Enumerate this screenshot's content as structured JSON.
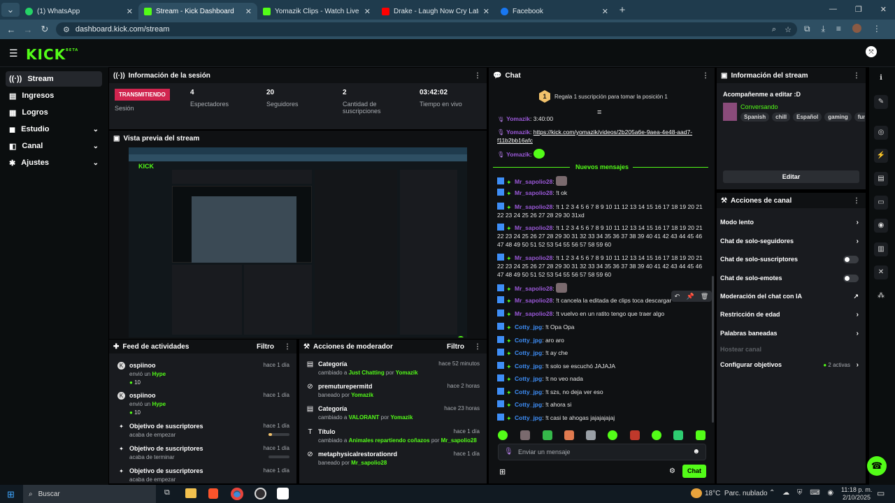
{
  "browser": {
    "tabs": [
      {
        "title": "(1) WhatsApp",
        "color": "#25d366"
      },
      {
        "title": "Stream - Kick Dashboard",
        "color": "#53fc18"
      },
      {
        "title": "Yomazik Clips - Watch Live on",
        "color": "#53fc18"
      },
      {
        "title": "Drake - Laugh Now Cry Later (C",
        "color": "#ff0000"
      },
      {
        "title": "Facebook",
        "color": "#1877f2"
      }
    ],
    "url": "dashboard.kick.com/stream"
  },
  "kick": {
    "logo": "KICK",
    "beta": "BETA",
    "sidebar": [
      {
        "label": "Stream",
        "icon": "broadcast-icon",
        "active": true
      },
      {
        "label": "Ingresos",
        "icon": "money-icon"
      },
      {
        "label": "Logros",
        "icon": "trophy-icon"
      },
      {
        "label": "Estudio",
        "icon": "studio-icon",
        "expand": true
      },
      {
        "label": "Canal",
        "icon": "channel-icon",
        "expand": true
      },
      {
        "label": "Ajustes",
        "icon": "gear-icon",
        "expand": true
      }
    ]
  },
  "session": {
    "title": "Información de la sesión",
    "badge": "TRANSMITIENDO",
    "badge_label": "Sesión",
    "stats": [
      {
        "value": "4",
        "label": "Espectadores"
      },
      {
        "value": "20",
        "label": "Seguidores"
      },
      {
        "value": "2",
        "label": "Cantidad de suscripciones"
      },
      {
        "value": "03:42:02",
        "label": "Tiempo en vivo"
      }
    ]
  },
  "preview": {
    "title": "Vista previa del stream"
  },
  "feed": {
    "title": "Feed de actividades",
    "filter": "Filtro",
    "items": [
      {
        "name": "ospiinoo",
        "sub_pre": "envió un ",
        "sub_hl": "Hype",
        "amount": "10",
        "time": "hace 1 día"
      },
      {
        "name": "ospiinoo",
        "sub_pre": "envió un ",
        "sub_hl": "Hype",
        "amount": "10",
        "time": "hace 1 día"
      },
      {
        "name": "Objetivo de suscriptores",
        "sub_pre": "acaba de empezar",
        "time": "hace 1 día",
        "progress": 0.18
      },
      {
        "name": "Objetivo de suscriptores",
        "sub_pre": "acaba de terminar",
        "time": "hace 1 día",
        "progress": 0
      },
      {
        "name": "Objetivo de suscriptores",
        "sub_pre": "acaba de empezar",
        "time": "hace 1 día"
      }
    ]
  },
  "modactions": {
    "title": "Acciones de moderador",
    "filter": "Filtro",
    "items": [
      {
        "name": "Categoría",
        "pre": "cambiado a ",
        "hl": "Just Chatting",
        "mid": " por ",
        "by": "Yomazik",
        "time": "hace 52 minutos",
        "icon": "category-icon"
      },
      {
        "name": "premuturepermitd",
        "pre": "baneado por ",
        "hl": "",
        "mid": "",
        "by": "Yomazik",
        "time": "hace 2 horas",
        "icon": "ban-icon"
      },
      {
        "name": "Categoría",
        "pre": "cambiado a ",
        "hl": "VALORANT",
        "mid": " por ",
        "by": "Yomazik",
        "time": "hace 23 horas",
        "icon": "category-icon"
      },
      {
        "name": "Título",
        "pre": "cambiado a ",
        "hl": "Animales repartiendo coñazos",
        "mid": " por ",
        "by": "Mr_sapolio28",
        "time": "hace 1 día",
        "icon": "title-icon"
      },
      {
        "name": "metaphysicalrestorationrd",
        "pre": "baneado por ",
        "hl": "",
        "mid": "",
        "by": "Mr_sapolio28",
        "time": "hace 1 día",
        "icon": "ban-icon"
      }
    ]
  },
  "chat": {
    "title": "Chat",
    "gift_text": "Regala 1 suscripción para tomar la posición 1",
    "gift_rank": "1",
    "new_messages": "Nuevos mensajes",
    "top_messages": [
      {
        "user": "Yomazik",
        "text": "3:40:00"
      },
      {
        "user": "Yomazik",
        "link": "https://kick.com/yomazik/videos/2b205a6e-9aea-4e48-aad7-f11b2bb16afc"
      },
      {
        "user": "Yomazik",
        "text": ""
      }
    ],
    "messages": [
      {
        "user": "Mr_sapolio28",
        "text": "",
        "emote": true
      },
      {
        "user": "Mr_sapolio28",
        "text": "!t ok"
      },
      {
        "user": "Mr_sapolio28",
        "text": "!t 1 2 3 4 5 6 7 8 9 10 11 12 13 14 15 16 17 18 19 20 21 22 23 24 25 26 27 28 29 30 31xd"
      },
      {
        "user": "Mr_sapolio28",
        "text": "!t 1 2 3 4 5 6 7 8 9 10 11 12 13 14 15 16 17 18 19 20 21 22 23 24 25 26 27 28 29 30 31 32 33 34 35 36 37 38 39 40 41 42 43 44 45 46 47 48 49 50 51 52 53 54 55 56 57 58 59 60"
      },
      {
        "user": "Mr_sapolio28",
        "text": "!t 1 2 3 4 5 6 7 8 9 10 11 12 13 14 15 16 17 18 19 20 21 22 23 24 25 26 27 28 29 30 31 32 33 34 35 36 37 38 39 40 41 42 43 44 45 46 47 48 49 50 51 52 53 54 55 56 57 58 59 60"
      },
      {
        "user": "Mr_sapolio28",
        "text": "",
        "emote": true
      },
      {
        "user": "Mr_sapolio28",
        "text": "!t   cancela la editada de clips toca descargar"
      },
      {
        "user": "Mr_sapolio28",
        "text": "!t vuelvo en un ratito tengo que traer algo"
      },
      {
        "user": "Cotty_jpg",
        "text": "!t Opa Opa"
      },
      {
        "user": "Cotty_jpg",
        "text": "aro aro"
      },
      {
        "user": "Cotty_jpg",
        "text": "!t ay che"
      },
      {
        "user": "Cotty_jpg",
        "text": "!t solo se escuchó JAJAJA"
      },
      {
        "user": "Cotty_jpg",
        "text": "!t no veo nada"
      },
      {
        "user": "Cotty_jpg",
        "text": "!t szs, no deja ver eso"
      },
      {
        "user": "Cotty_jpg",
        "text": "!t ahora si"
      },
      {
        "user": "Cotty_jpg",
        "text": "!t casi te ahogas jajajajajaj"
      }
    ],
    "input_placeholder": "Enviar un mensaje",
    "send": "Chat"
  },
  "streaminfo": {
    "title": "Información del stream",
    "stream_title": "Acompañenme a editar :D",
    "category": "Conversando",
    "tags": [
      "Spanish",
      "chill",
      "Español",
      "gaming",
      "funny"
    ],
    "edit": "Editar"
  },
  "channel_actions": {
    "title": "Acciones de canal",
    "rows": [
      {
        "label": "Modo lento",
        "type": "arrow"
      },
      {
        "label": "Chat de solo-seguidores",
        "type": "arrow"
      },
      {
        "label": "Chat de solo-suscriptores",
        "type": "toggle"
      },
      {
        "label": "Chat de solo-emotes",
        "type": "toggle"
      },
      {
        "label": "Moderación del chat con IA",
        "type": "external"
      },
      {
        "label": "Restricción de edad",
        "type": "arrow"
      },
      {
        "label": "Palabras baneadas",
        "type": "arrow"
      },
      {
        "label": "Hostear canal",
        "type": "disabled"
      },
      {
        "label": "Configurar objetivos",
        "type": "arrow",
        "extra": "2 activas"
      }
    ]
  },
  "taskbar": {
    "search": "Buscar",
    "weather": "18°C  Parc. nublado",
    "time": "11:18 p. m.",
    "date": "2/10/2025"
  }
}
